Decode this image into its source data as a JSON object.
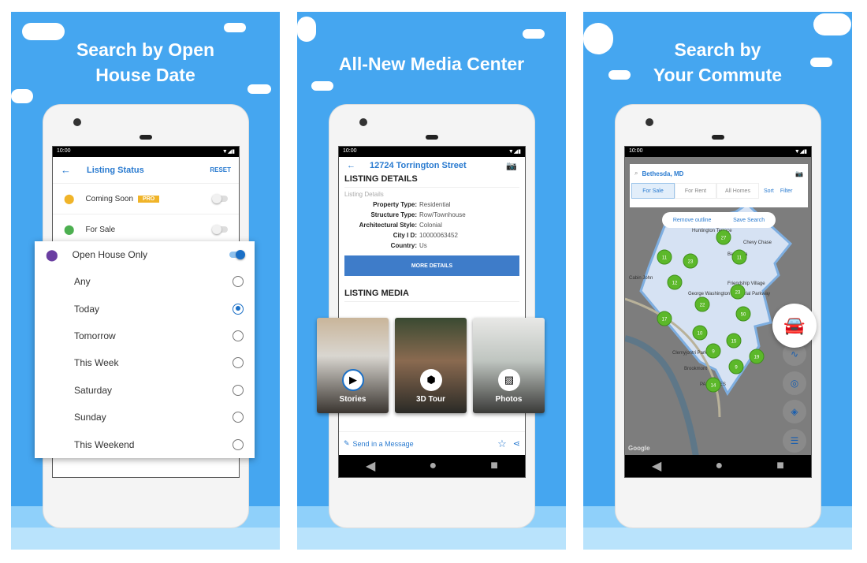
{
  "panels": [
    {
      "headline_line1": "Search by Open",
      "headline_line2": "House Date"
    },
    {
      "headline": "All-New Media Center"
    },
    {
      "headline_line1": "Search by",
      "headline_line2": "Your Commute"
    }
  ],
  "status_time": "10:00",
  "listing_status": {
    "title": "Listing Status",
    "reset": "RESET",
    "items": [
      {
        "label": "Coming Soon",
        "badge": "PRO",
        "pin_color": "#f0b429"
      },
      {
        "label": "For Sale",
        "pin_color": "#4caf50"
      }
    ]
  },
  "open_house": {
    "label": "Open House Only",
    "pin_color": "#6a3ea1",
    "enabled": true,
    "options": [
      "Any",
      "Today",
      "Tomorrow",
      "This Week",
      "Saturday",
      "Sunday",
      "This Weekend"
    ],
    "selected": "Today"
  },
  "listing": {
    "address": "12724 Torrington Street",
    "section_title": "LISTING DETAILS",
    "sub": "Listing Details",
    "fields": [
      {
        "k": "Property Type:",
        "v": "Residential"
      },
      {
        "k": "Structure Type:",
        "v": "Row/Townhouse"
      },
      {
        "k": "Architectural Style:",
        "v": "Colonial"
      },
      {
        "k": "City I D:",
        "v": "10000063452"
      },
      {
        "k": "Country:",
        "v": "Us"
      }
    ],
    "more": "MORE DETAILS",
    "media_title": "LISTING MEDIA",
    "media": [
      {
        "label": "Stories",
        "icon": "play-icon"
      },
      {
        "label": "3D Tour",
        "icon": "cube-icon"
      },
      {
        "label": "Photos",
        "icon": "image-icon"
      }
    ],
    "message": "Send in a Message"
  },
  "map": {
    "search": "Bethesda, MD",
    "tabs": [
      "For Sale",
      "For Rent",
      "All Homes"
    ],
    "active_tab": "For Sale",
    "sort": "Sort",
    "filter": "Filter",
    "remove": "Remove outline",
    "save": "Save Search",
    "places": [
      "Huntington Terrace",
      "Chevy Chase",
      "Bethesda",
      "Cabin John",
      "George Washington Memorial Parkway",
      "Friendship Village",
      "Clemyjontri Park",
      "Brookmont",
      "PALISADES",
      "Washington DC Temple"
    ],
    "clusters": [
      "27",
      "11",
      "23",
      "11",
      "12",
      "23",
      "22",
      "50",
      "17",
      "10",
      "15",
      "19",
      "9",
      "9",
      "14"
    ],
    "google": "Google",
    "accent": "#5cb82a"
  }
}
